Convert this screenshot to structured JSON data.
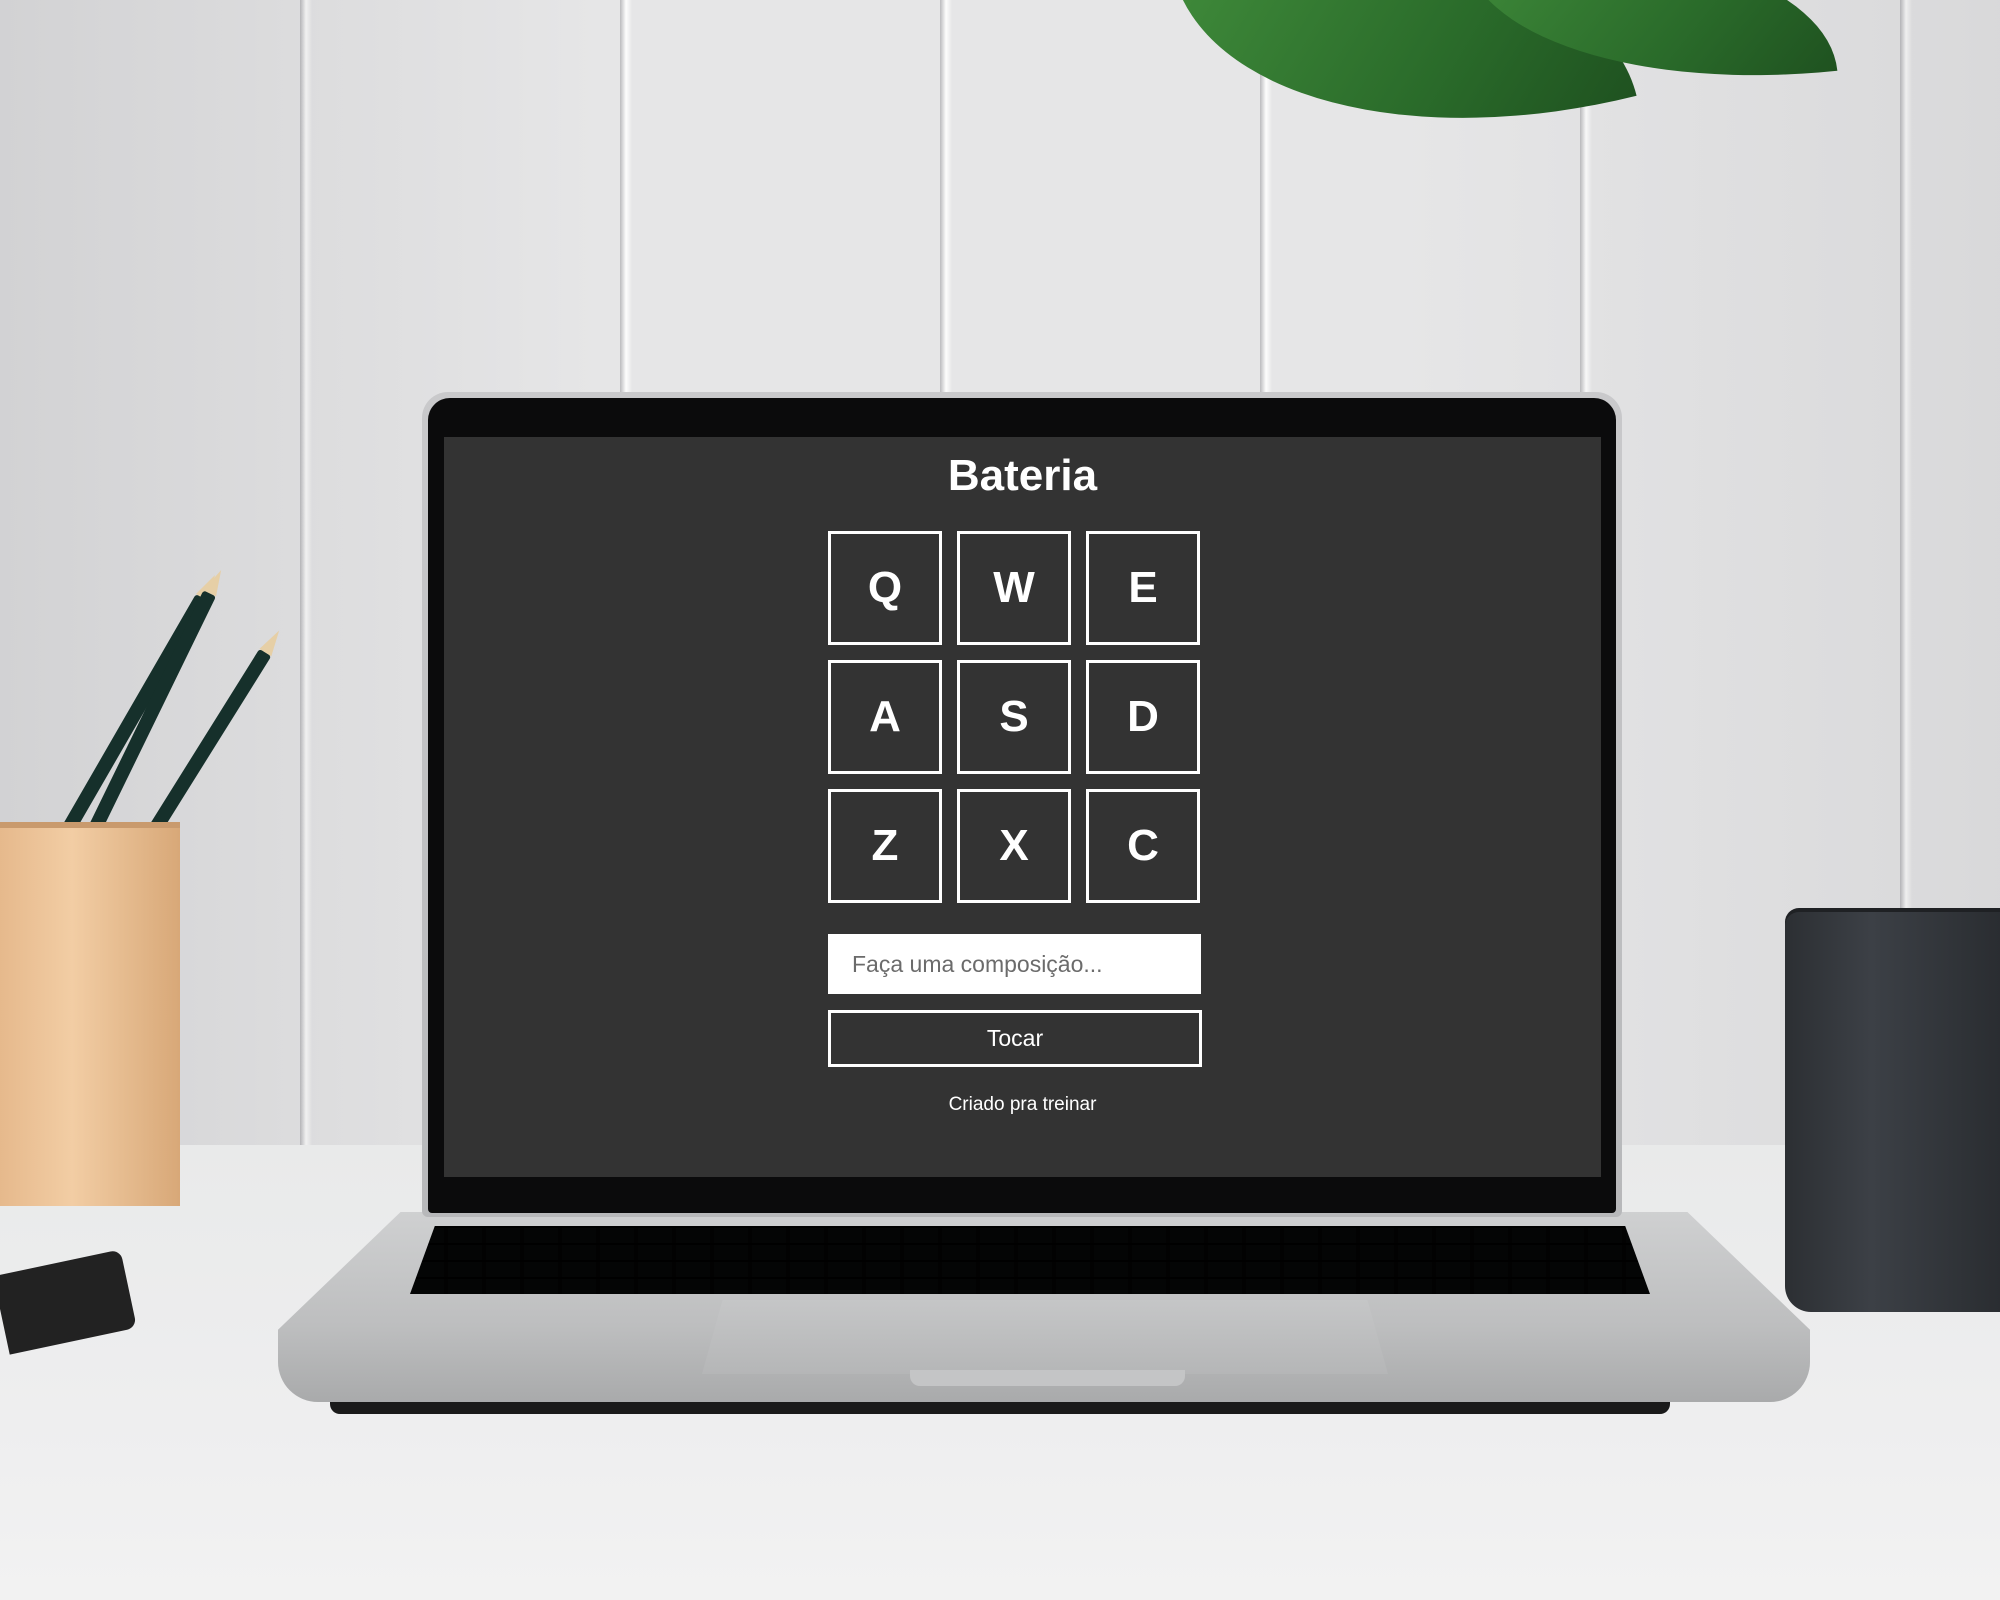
{
  "app": {
    "title": "Bateria",
    "pads": [
      {
        "key": "Q"
      },
      {
        "key": "W"
      },
      {
        "key": "E"
      },
      {
        "key": "A"
      },
      {
        "key": "S"
      },
      {
        "key": "D"
      },
      {
        "key": "Z"
      },
      {
        "key": "X"
      },
      {
        "key": "C"
      }
    ],
    "composition_input": {
      "value": "",
      "placeholder": "Faça uma composição..."
    },
    "play_button_label": "Tocar",
    "footer_text": "Criado pra treinar"
  },
  "colors": {
    "background": "#333333",
    "foreground": "#ffffff",
    "input_background": "#ffffff"
  }
}
